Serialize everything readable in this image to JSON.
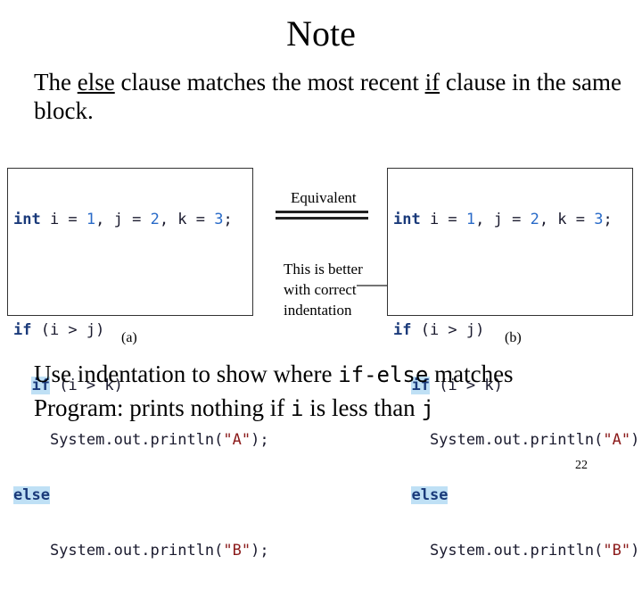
{
  "slide": {
    "title": "Note",
    "intro": {
      "pre": "The ",
      "else_word": "else",
      "mid": " clause matches the most recent ",
      "if_word": "if",
      "post": " clause in the same block."
    },
    "page_number": "22"
  },
  "figure": {
    "code_a": {
      "line1": {
        "kw": "int",
        "t1": " i = ",
        "n1": "1",
        "t2": ", j = ",
        "n2": "2",
        "t3": ", k = ",
        "n3": "3",
        "t4": ";"
      },
      "line3": {
        "kw": "if",
        "rest": " (i > j)"
      },
      "line4": {
        "indent": "  ",
        "kw": "if",
        "rest": " (i > k)"
      },
      "line5": {
        "pre": "    System.out.println(",
        "str": "\"A\"",
        "post": ");"
      },
      "line6": {
        "kw": "else"
      },
      "line7": {
        "pre": "    System.out.println(",
        "str": "\"B\"",
        "post": ");"
      }
    },
    "code_b": {
      "line1": {
        "kw": "int",
        "t1": " i = ",
        "n1": "1",
        "t2": ", j = ",
        "n2": "2",
        "t3": ", k = ",
        "n3": "3",
        "t4": ";"
      },
      "line3": {
        "kw": "if",
        "rest": " (i > j)"
      },
      "line4": {
        "indent": "  ",
        "kw": "if",
        "rest": " (i > k)"
      },
      "line5": {
        "pre": "    System.out.println(",
        "str": "\"A\"",
        "post": ");"
      },
      "line6": {
        "indent": "  ",
        "kw": "else"
      },
      "line7": {
        "pre": "    System.out.println(",
        "str": "\"B\"",
        "post": ");"
      }
    },
    "equivalent_label": "Equivalent",
    "note_lines": [
      "This is better",
      "with correct",
      "indentation"
    ],
    "caption_a": "(a)",
    "caption_b": "(b)"
  },
  "bottom": {
    "line1": {
      "pre": "Use indentation to show where ",
      "code": "if-else",
      "post": " matches"
    },
    "line2": {
      "pre": "Program: prints nothing if ",
      "code1": "i",
      "mid": " is less than ",
      "code2": "j"
    }
  },
  "colors": {
    "keyword": "#1a3a7a",
    "number": "#2a6bc8",
    "string": "#8b1a1a",
    "highlight": "#bfe0f5"
  }
}
